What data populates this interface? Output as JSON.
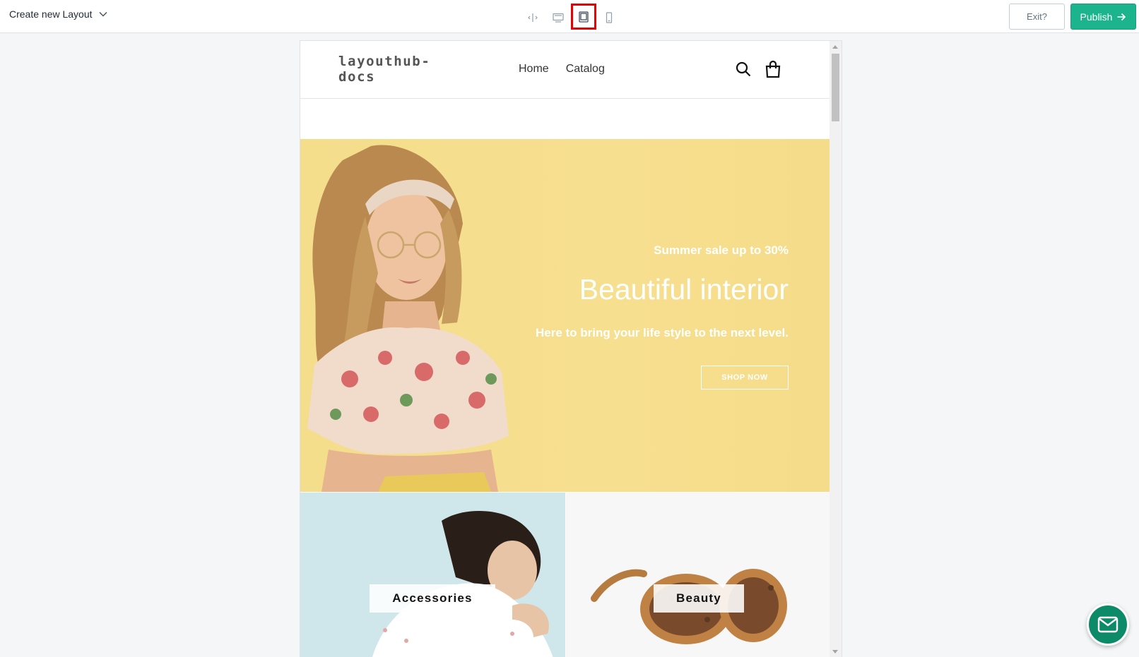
{
  "editor": {
    "layout_select_label": "Create new Layout",
    "device_modes": [
      {
        "name": "fullwidth",
        "icon": "resize-horizontal-icon",
        "active": false
      },
      {
        "name": "desktop",
        "icon": "desktop-icon",
        "active": false
      },
      {
        "name": "tablet",
        "icon": "tablet-icon",
        "active": true
      },
      {
        "name": "mobile",
        "icon": "mobile-icon",
        "active": false
      }
    ],
    "exit_label": "Exit?",
    "publish_label": "Publish",
    "accent_color": "#1cb48c",
    "highlight_color": "#e60000"
  },
  "site": {
    "logo": "layouthub-docs",
    "nav": [
      "Home",
      "Catalog"
    ],
    "icons": [
      "search-icon",
      "shopping-bag-icon"
    ]
  },
  "hero": {
    "subtitle": "Summer sale up to 30%",
    "title": "Beautiful interior",
    "description": "Here to bring your life style to the next level.",
    "cta": "SHOP NOW",
    "background": "#f5dd8c"
  },
  "tiles": [
    {
      "label": "Accessories",
      "background": "#cfe7eb"
    },
    {
      "label": "Beauty",
      "background": "#f7f7f7"
    }
  ],
  "chat": {
    "icon": "mail-icon",
    "color": "#0d8a68"
  }
}
